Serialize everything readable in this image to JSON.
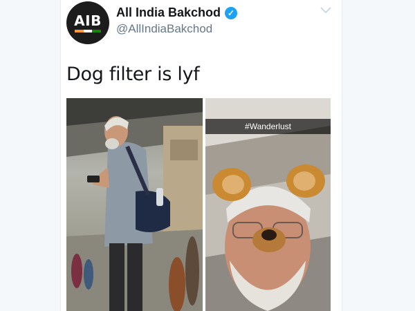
{
  "tweet": {
    "avatar_text": "AIB",
    "display_name": "All India Bakchod",
    "handle": "@AllIndiaBakchod",
    "text": "Dog filter is lyf",
    "media": {
      "left_photo": "photo-man-reading-at-station",
      "right_photo": "photo-selfie-with-dog-filter",
      "right_caption": "#Wanderlust"
    }
  },
  "colors": {
    "verified_blue": "#1da1f2",
    "text_dark": "#14171a",
    "text_gray": "#657786",
    "avatar_bg": "#1c1c1c",
    "flag_saffron": "#ff9933",
    "flag_white": "#ffffff",
    "flag_green": "#138808"
  },
  "icons": {
    "verified": "verified-check-icon",
    "menu": "chevron-down-icon"
  }
}
